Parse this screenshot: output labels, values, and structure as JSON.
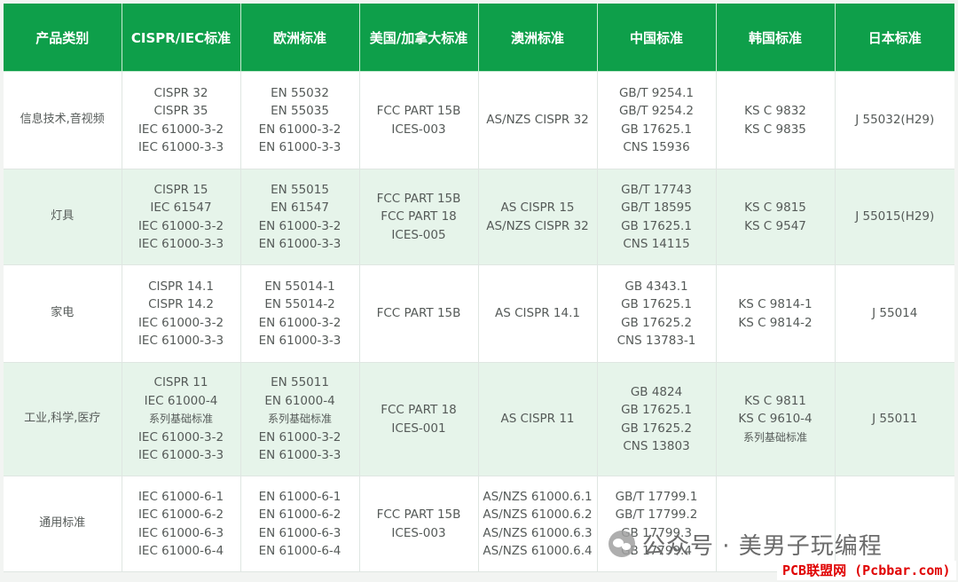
{
  "headers": [
    "产品类别",
    "CISPR/IEC标准",
    "欧洲标准",
    "美国/加拿大标准",
    "澳洲标准",
    "中国标准",
    "韩国标准",
    "日本标准"
  ],
  "rows": [
    {
      "category": "信息技术,音视频",
      "cispr_iec": [
        "CISPR 32",
        "CISPR 35",
        "IEC 61000-3-2",
        "IEC 61000-3-3"
      ],
      "europe": [
        "EN 55032",
        "EN 55035",
        "EN 61000-3-2",
        "EN 61000-3-3"
      ],
      "us_canada": [
        "FCC PART 15B",
        "ICES-003"
      ],
      "australia": [
        "AS/NZS CISPR 32"
      ],
      "china": [
        "GB/T 9254.1",
        "GB/T 9254.2",
        "GB 17625.1",
        "CNS 15936"
      ],
      "korea": [
        "KS C 9832",
        "KS C 9835"
      ],
      "japan": [
        "J 55032(H29)"
      ]
    },
    {
      "category": "灯具",
      "cispr_iec": [
        "CISPR 15",
        "IEC 61547",
        "IEC 61000-3-2",
        "IEC 61000-3-3"
      ],
      "europe": [
        "EN 55015",
        "EN 61547",
        "EN 61000-3-2",
        "EN 61000-3-3"
      ],
      "us_canada": [
        "FCC PART 15B",
        "FCC PART 18",
        "ICES-005"
      ],
      "australia": [
        "AS CISPR 15",
        "AS/NZS CISPR 32"
      ],
      "china": [
        "GB/T 17743",
        "GB/T 18595",
        "GB 17625.1",
        "CNS 14115"
      ],
      "korea": [
        "KS C 9815",
        "KS C 9547"
      ],
      "japan": [
        "J 55015(H29)"
      ]
    },
    {
      "category": "家电",
      "cispr_iec": [
        "CISPR 14.1",
        "CISPR 14.2",
        "IEC 61000-3-2",
        "IEC 61000-3-3"
      ],
      "europe": [
        "EN 55014-1",
        "EN 55014-2",
        "EN 61000-3-2",
        "EN 61000-3-3"
      ],
      "us_canada": [
        "FCC PART 15B"
      ],
      "australia": [
        "AS CISPR 14.1"
      ],
      "china": [
        "GB 4343.1",
        "GB 17625.1",
        "GB 17625.2",
        "CNS 13783-1"
      ],
      "korea": [
        "KS C 9814-1",
        "KS C 9814-2"
      ],
      "japan": [
        "J 55014"
      ]
    },
    {
      "category": "工业,科学,医疗",
      "cispr_iec": [
        "CISPR 11",
        "IEC 61000-4",
        "系列基础标准",
        "IEC 61000-3-2",
        "IEC 61000-3-3"
      ],
      "europe": [
        "EN 55011",
        "EN 61000-4",
        "系列基础标准",
        "EN 61000-3-2",
        "EN 61000-3-3"
      ],
      "us_canada": [
        "FCC PART 18",
        "ICES-001"
      ],
      "australia": [
        "AS CISPR 11"
      ],
      "china": [
        "GB 4824",
        "GB 17625.1",
        "GB 17625.2",
        "CNS 13803"
      ],
      "korea": [
        "KS C 9811",
        "KS C 9610-4",
        "系列基础标准"
      ],
      "japan": [
        "J 55011"
      ]
    },
    {
      "category": "通用标准",
      "cispr_iec": [
        "IEC 61000-6-1",
        "IEC 61000-6-2",
        "IEC 61000-6-3",
        "IEC 61000-6-4"
      ],
      "europe": [
        "EN 61000-6-1",
        "EN 61000-6-2",
        "EN 61000-6-3",
        "EN 61000-6-4"
      ],
      "us_canada": [
        "FCC PART 15B",
        "ICES-003"
      ],
      "australia": [
        "AS/NZS 61000.6.1",
        "AS/NZS 61000.6.2",
        "AS/NZS 61000.6.3",
        "AS/NZS 61000.6.4"
      ],
      "china": [
        "GB/T 17799.1",
        "GB/T 17799.2",
        "GB 17799.3",
        "GB 17799.4"
      ],
      "korea": [],
      "japan": []
    }
  ],
  "watermark": {
    "text": "公众号 · 美男子玩编程",
    "icon": "wechat-icon"
  },
  "site_mark": "PCB联盟网 (Pcbbar.com)",
  "colors": {
    "header_bg": "#0e9f4a",
    "stripe_bg": "#e6f4ea",
    "text": "#555a58",
    "site_mark": "#e00000"
  }
}
